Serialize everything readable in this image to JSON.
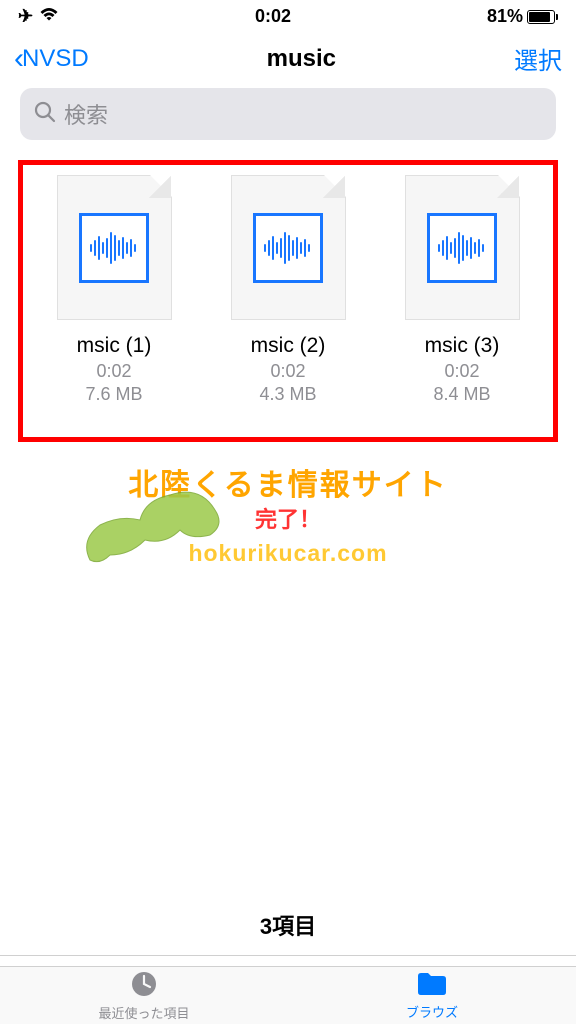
{
  "status": {
    "time": "0:02",
    "battery_percent": "81%"
  },
  "nav": {
    "back_label": "NVSD",
    "title": "music",
    "select_label": "選択"
  },
  "search": {
    "placeholder": "検索"
  },
  "files": [
    {
      "name": "msic (1)",
      "duration": "0:02",
      "size": "7.6 MB"
    },
    {
      "name": "msic (2)",
      "duration": "0:02",
      "size": "4.3 MB"
    },
    {
      "name": "msic (3)",
      "duration": "0:02",
      "size": "8.4 MB"
    }
  ],
  "watermark": {
    "line1": "北陸くるま情報サイト",
    "done": "完了！",
    "line2": "hokurikucar.com"
  },
  "summary": {
    "count_label": "3項目"
  },
  "tabs": {
    "recent": "最近使った項目",
    "browse": "ブラウズ"
  }
}
